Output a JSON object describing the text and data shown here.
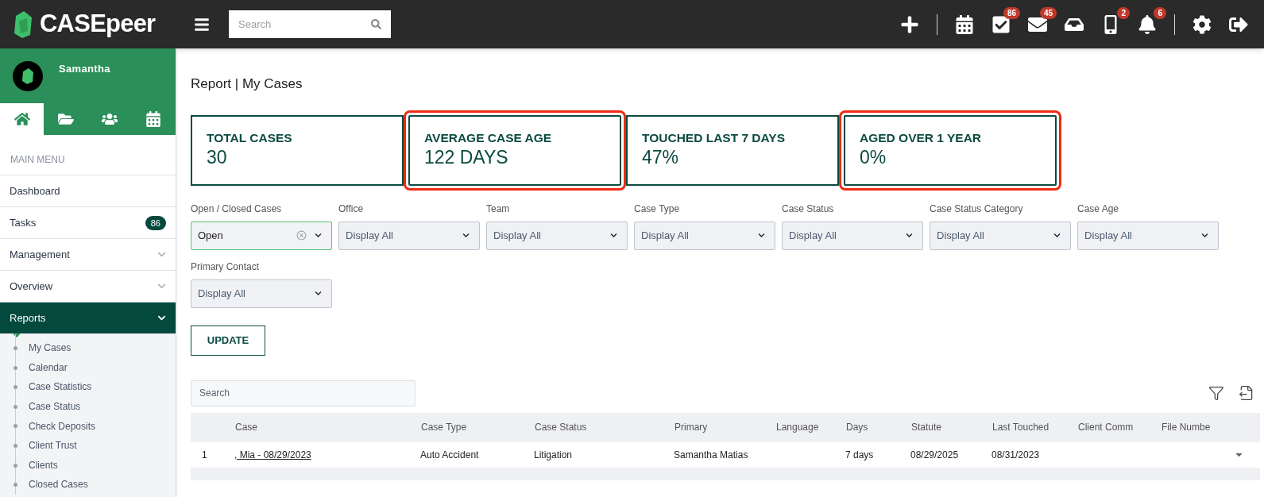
{
  "header": {
    "logo": "CASEpeer",
    "search": {
      "placeholder": "Search"
    },
    "actions": [
      {
        "kind": "plus"
      },
      {
        "kind": "divider"
      },
      {
        "kind": "calendar"
      },
      {
        "kind": "tasks",
        "badge": "86"
      },
      {
        "kind": "mail",
        "badge": "45"
      },
      {
        "kind": "inbox"
      },
      {
        "kind": "phone",
        "badge": "2"
      },
      {
        "kind": "bell",
        "badge": "6"
      },
      {
        "kind": "divider"
      },
      {
        "kind": "settings"
      },
      {
        "kind": "logout"
      }
    ]
  },
  "sidebar": {
    "user": "Samantha",
    "tabs": [
      {
        "kind": "home",
        "selected": true
      },
      {
        "kind": "folder",
        "selected": false
      },
      {
        "kind": "people",
        "selected": false
      },
      {
        "kind": "calendar",
        "selected": false
      }
    ],
    "menu_label": "MAIN MENU",
    "items": [
      {
        "label": "Dashboard",
        "expandable": false,
        "expanded": false
      },
      {
        "label": "Tasks",
        "badge": "86",
        "expandable": false,
        "expanded": false
      },
      {
        "label": "Management",
        "expandable": true,
        "expanded": false
      },
      {
        "label": "Overview",
        "expandable": true,
        "expanded": false
      },
      {
        "label": "Reports",
        "expandable": true,
        "expanded": true,
        "children": [
          {
            "label": "My Cases"
          },
          {
            "label": "Calendar"
          },
          {
            "label": "Case Statistics"
          },
          {
            "label": "Case Status"
          },
          {
            "label": "Check Deposits"
          },
          {
            "label": "Client Trust"
          },
          {
            "label": "Clients"
          },
          {
            "label": "Closed Cases"
          }
        ]
      }
    ]
  },
  "page_title": "Report | My Cases",
  "stats": [
    {
      "label": "TOTAL CASES",
      "value": "30",
      "highlighted": false
    },
    {
      "label": "AVERAGE CASE AGE",
      "value": "122 DAYS",
      "highlighted": true
    },
    {
      "label": "TOUCHED LAST 7 DAYS",
      "value": "47%",
      "highlighted": false
    },
    {
      "label": "AGED OVER 1 YEAR",
      "value": "0%",
      "highlighted": true
    }
  ],
  "filters": [
    {
      "label": "Open / Closed Cases",
      "value": "Open",
      "active": true
    },
    {
      "label": "Office",
      "value": "Display All",
      "active": false
    },
    {
      "label": "Team",
      "value": "Display All",
      "active": false
    },
    {
      "label": "Case Type",
      "value": "Display All",
      "active": false
    },
    {
      "label": "Case Status",
      "value": "Display All",
      "active": false
    },
    {
      "label": "Case Status Category",
      "value": "Display All",
      "active": false
    },
    {
      "label": "Case Age",
      "value": "Display All",
      "active": false
    },
    {
      "label": "Primary Contact",
      "value": "Display All",
      "active": false
    }
  ],
  "update_button": "UPDATE",
  "table": {
    "search": {
      "placeholder": "Search"
    },
    "columns": [
      "Case",
      "Case Type",
      "Case Status",
      "Primary",
      "Language",
      "Days",
      "Statute",
      "Last Touched",
      "Client Comm",
      "File Numbe"
    ],
    "rows": [
      {
        "index": "1",
        "cells": [
          ", Mia - 08/29/2023",
          "Auto Accident",
          "Litigation",
          "Samantha Matias",
          "",
          "7 days",
          "08/29/2025",
          "08/31/2023",
          "",
          ""
        ],
        "expanded": false
      }
    ]
  }
}
